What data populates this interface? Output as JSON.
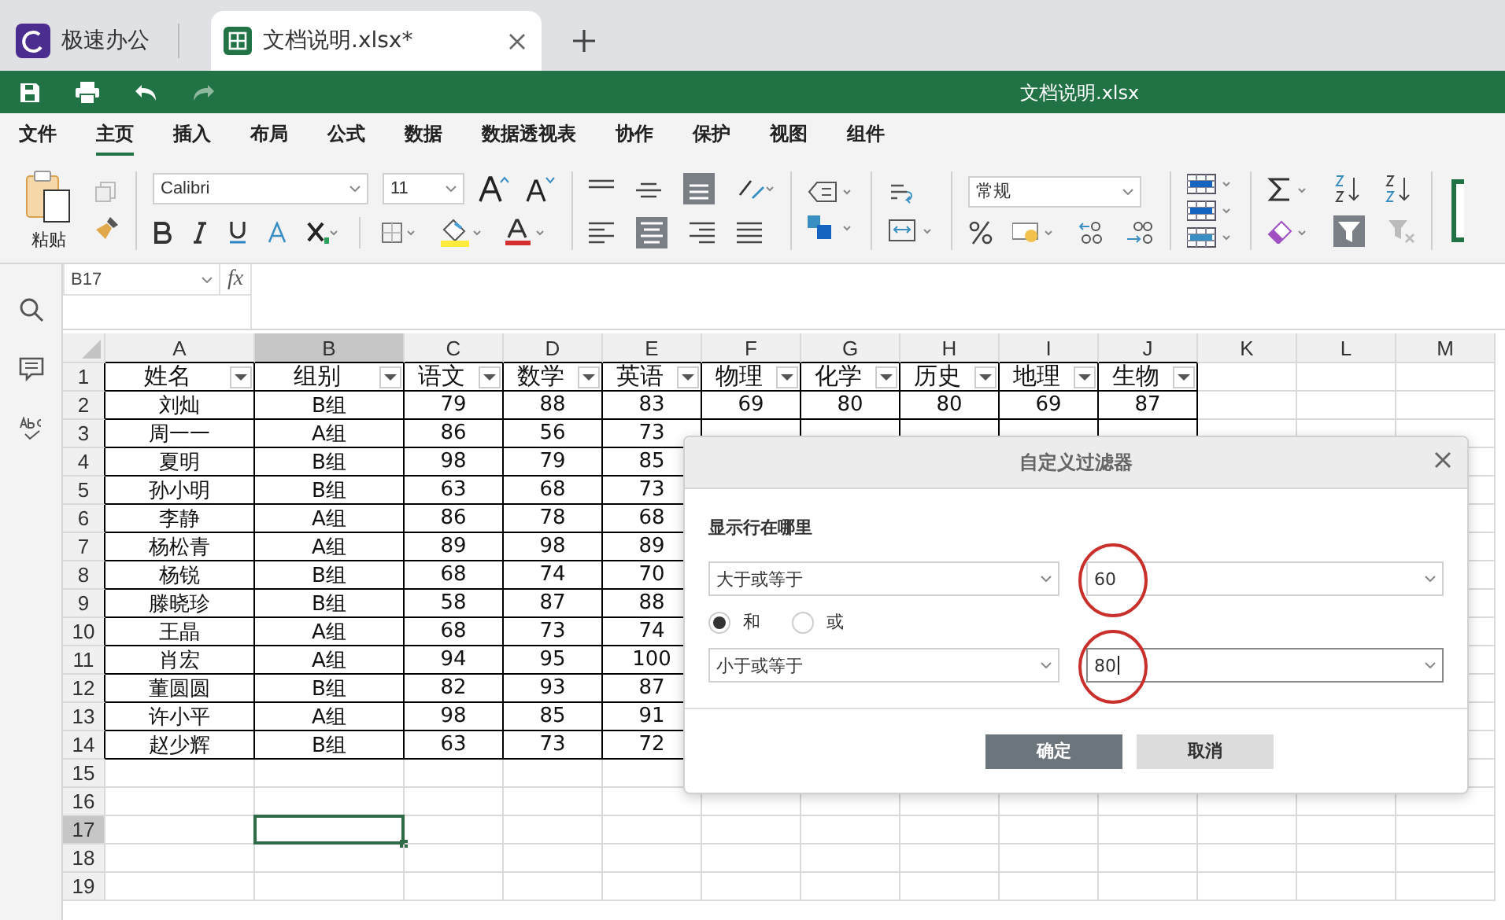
{
  "app_tabs": [
    {
      "kind": "home",
      "label": "极速办公",
      "selected": false
    },
    {
      "kind": "document",
      "label": "文档说明.xlsx*",
      "selected": true
    }
  ],
  "title_bar": {
    "title": "文档说明.xlsx"
  },
  "menu": [
    {
      "label": "文件",
      "selected": false
    },
    {
      "label": "主页",
      "selected": true
    },
    {
      "label": "插入",
      "selected": false
    },
    {
      "label": "布局",
      "selected": false
    },
    {
      "label": "公式",
      "selected": false
    },
    {
      "label": "数据",
      "selected": false
    },
    {
      "label": "数据透视表",
      "selected": false
    },
    {
      "label": "协作",
      "selected": false
    },
    {
      "label": "保护",
      "selected": false
    },
    {
      "label": "视图",
      "selected": false
    },
    {
      "label": "组件",
      "selected": false
    }
  ],
  "ribbon": {
    "paste_label": "粘贴",
    "font_name": "Calibri",
    "font_size": "11",
    "number_format": "常规"
  },
  "formula_bar": {
    "cell_ref": "B17",
    "fx_label": "fx"
  },
  "sheet": {
    "columns": [
      {
        "label": "A",
        "selected": false
      },
      {
        "label": "B",
        "selected": true
      },
      {
        "label": "C",
        "selected": false
      },
      {
        "label": "D",
        "selected": false
      },
      {
        "label": "E",
        "selected": false
      },
      {
        "label": "F",
        "selected": false
      },
      {
        "label": "G",
        "selected": false
      },
      {
        "label": "H",
        "selected": false
      },
      {
        "label": "I",
        "selected": false
      },
      {
        "label": "J",
        "selected": false
      },
      {
        "label": "K",
        "selected": false
      },
      {
        "label": "L",
        "selected": false
      },
      {
        "label": "M",
        "selected": false
      }
    ],
    "rows": [
      {
        "number": "1",
        "selected": false,
        "kind": "header",
        "cells": [
          "姓名",
          "组别",
          "语文",
          "数学",
          "英语",
          "物理",
          "化学",
          "历史",
          "地理",
          "生物"
        ]
      },
      {
        "number": "2",
        "selected": false,
        "kind": "data",
        "cells": [
          "刘灿",
          "B组",
          "79",
          "88",
          "83",
          "69",
          "80",
          "80",
          "69",
          "87"
        ]
      },
      {
        "number": "3",
        "selected": false,
        "kind": "data",
        "cells": [
          "周一一",
          "A组",
          "86",
          "56",
          "73"
        ]
      },
      {
        "number": "4",
        "selected": false,
        "kind": "data",
        "cells": [
          "夏明",
          "B组",
          "98",
          "79",
          "85"
        ]
      },
      {
        "number": "5",
        "selected": false,
        "kind": "data",
        "cells": [
          "孙小明",
          "B组",
          "63",
          "68",
          "73"
        ]
      },
      {
        "number": "6",
        "selected": false,
        "kind": "data",
        "cells": [
          "李静",
          "A组",
          "86",
          "78",
          "68"
        ]
      },
      {
        "number": "7",
        "selected": false,
        "kind": "data",
        "cells": [
          "杨松青",
          "A组",
          "89",
          "98",
          "89"
        ]
      },
      {
        "number": "8",
        "selected": false,
        "kind": "data",
        "cells": [
          "杨锐",
          "B组",
          "68",
          "74",
          "70"
        ]
      },
      {
        "number": "9",
        "selected": false,
        "kind": "data",
        "cells": [
          "滕晓珍",
          "B组",
          "58",
          "87",
          "88"
        ]
      },
      {
        "number": "10",
        "selected": false,
        "kind": "data",
        "cells": [
          "王晶",
          "A组",
          "68",
          "73",
          "74"
        ]
      },
      {
        "number": "11",
        "selected": false,
        "kind": "data",
        "cells": [
          "肖宏",
          "A组",
          "94",
          "95",
          "100"
        ]
      },
      {
        "number": "12",
        "selected": false,
        "kind": "data",
        "cells": [
          "董圆圆",
          "B组",
          "82",
          "93",
          "87"
        ]
      },
      {
        "number": "13",
        "selected": false,
        "kind": "data",
        "cells": [
          "许小平",
          "A组",
          "98",
          "85",
          "91"
        ]
      },
      {
        "number": "14",
        "selected": false,
        "kind": "data",
        "cells": [
          "赵少辉",
          "B组",
          "63",
          "73",
          "72"
        ]
      },
      {
        "number": "15",
        "selected": false,
        "kind": "empty"
      },
      {
        "number": "16",
        "selected": false,
        "kind": "empty"
      },
      {
        "number": "17",
        "selected": true,
        "kind": "empty"
      },
      {
        "number": "18",
        "selected": false,
        "kind": "empty"
      },
      {
        "number": "19",
        "selected": false,
        "kind": "empty"
      }
    ]
  },
  "dialog": {
    "title": "自定义过滤器",
    "prompt": "显示行在哪里",
    "conditions": [
      {
        "operator": "大于或等于",
        "value": "60",
        "focused": false,
        "highlighted": true
      },
      {
        "operator": "小于或等于",
        "value": "80",
        "focused": true,
        "highlighted": true
      }
    ],
    "joins": [
      {
        "label": "和",
        "selected": true
      },
      {
        "label": "或",
        "selected": false
      }
    ],
    "buttons": [
      {
        "label": "确定",
        "kind": "primary"
      },
      {
        "label": "取消",
        "kind": "secondary"
      }
    ]
  }
}
